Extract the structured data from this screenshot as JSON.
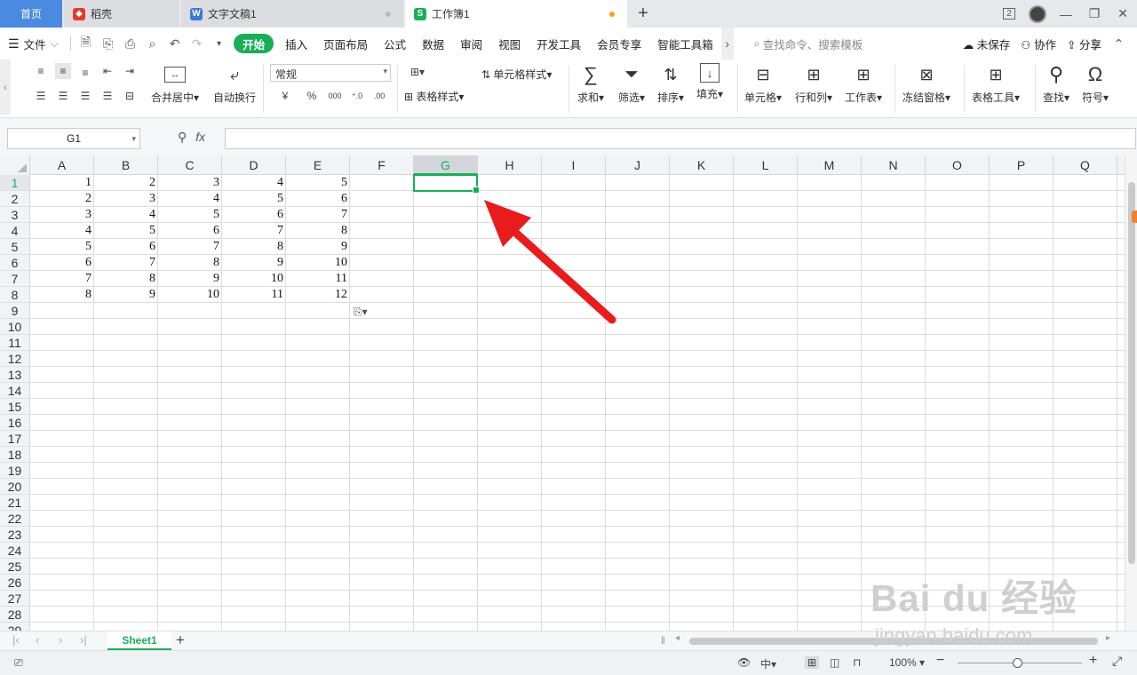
{
  "tabs": {
    "home": "首页",
    "daoke": "稻壳",
    "doc": "文字文稿1",
    "book": "工作簿1",
    "badge": "2"
  },
  "menu": {
    "file": "文件",
    "items": [
      "开始",
      "插入",
      "页面布局",
      "公式",
      "数据",
      "审阅",
      "视图",
      "开发工具",
      "会员专享",
      "智能工具箱"
    ],
    "search": "查找命令、搜索模板",
    "unsaved": "未保存",
    "collab": "协作",
    "share": "分享"
  },
  "ribbon": {
    "merge": "合并居中",
    "wrap": "自动换行",
    "format": "常规",
    "currency": "¥",
    "percent": "%",
    "cell_style": "单元格样式",
    "table_style": "表格样式",
    "sum": "求和",
    "filter": "筛选",
    "sort": "排序",
    "fill": "填充",
    "cell": "单元格",
    "rowcol": "行和列",
    "sheet": "工作表",
    "freeze": "冻结窗格",
    "tools": "表格工具",
    "find": "查找",
    "symbol": "符号"
  },
  "formula_bar": {
    "name_box": "G1",
    "fx": "fx",
    "value": ""
  },
  "grid": {
    "columns": [
      "A",
      "B",
      "C",
      "D",
      "E",
      "F",
      "G",
      "H",
      "I",
      "J",
      "K",
      "L",
      "M",
      "N",
      "O",
      "P",
      "Q"
    ],
    "selected_col": "G",
    "selected_row": 1,
    "rows": [
      [
        1,
        2,
        3,
        4,
        5
      ],
      [
        2,
        3,
        4,
        5,
        6
      ],
      [
        3,
        4,
        5,
        6,
        7
      ],
      [
        4,
        5,
        6,
        7,
        8
      ],
      [
        5,
        6,
        7,
        8,
        9
      ],
      [
        6,
        7,
        8,
        9,
        10
      ],
      [
        7,
        8,
        9,
        10,
        11
      ],
      [
        8,
        9,
        10,
        11,
        12
      ]
    ],
    "row_count": 29
  },
  "sheets": {
    "active": "Sheet1"
  },
  "status": {
    "zoom": "100%"
  },
  "watermark": {
    "main": "Bai du 经验",
    "url": "jingyan.baidu.com"
  },
  "colors": {
    "accent": "#1aad5a",
    "arrow": "#e81c1c",
    "tab_home": "#4a8ae0"
  }
}
